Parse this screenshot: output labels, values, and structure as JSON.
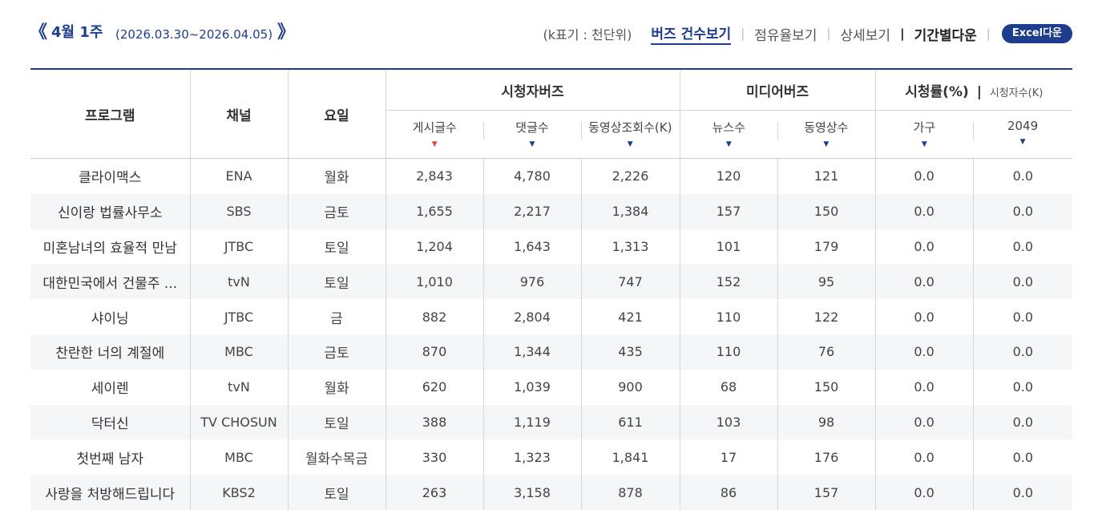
{
  "header": {
    "prev_icon": "《",
    "next_icon": "》",
    "week_label": "4월 1주",
    "date_range": "(2026.03.30~2026.04.05)",
    "unit_note": "(k표기 : 천단위)",
    "links": {
      "buzz_count": "버즈 건수보기",
      "share": "점유율보기",
      "detail": "상세보기",
      "period_download": "기간별다운"
    },
    "separator": "|",
    "excel_button": "Excel다운"
  },
  "table": {
    "headers": {
      "program": "프로그램",
      "channel": "채널",
      "day": "요일",
      "viewer_buzz": "시청자버즈",
      "media_buzz": "미디어버즈",
      "ratings": "시청률(%)",
      "ratings_sep": "|",
      "viewers_k": "시청자수(K)",
      "sub": [
        "게시글수",
        "댓글수",
        "동영상조회수(K)",
        "뉴스수",
        "동영상수",
        "가구",
        "2049"
      ]
    },
    "sort_up_icon": "▼",
    "sort_down_icon": "▼",
    "rows": [
      {
        "program": "클라이맥스",
        "channel": "ENA",
        "day": "월화",
        "posts": "2,843",
        "comments": "4,780",
        "video_views": "2,226",
        "news": "120",
        "videos": "121",
        "household": "0.0",
        "r2049": "0.0"
      },
      {
        "program": "신이랑 법률사무소",
        "channel": "SBS",
        "day": "금토",
        "posts": "1,655",
        "comments": "2,217",
        "video_views": "1,384",
        "news": "157",
        "videos": "150",
        "household": "0.0",
        "r2049": "0.0"
      },
      {
        "program": "미혼남녀의 효율적 만남",
        "channel": "JTBC",
        "day": "토일",
        "posts": "1,204",
        "comments": "1,643",
        "video_views": "1,313",
        "news": "101",
        "videos": "179",
        "household": "0.0",
        "r2049": "0.0"
      },
      {
        "program": "대한민국에서 건물주 ...",
        "channel": "tvN",
        "day": "토일",
        "posts": "1,010",
        "comments": "976",
        "video_views": "747",
        "news": "152",
        "videos": "95",
        "household": "0.0",
        "r2049": "0.0"
      },
      {
        "program": "샤이닝",
        "channel": "JTBC",
        "day": "금",
        "posts": "882",
        "comments": "2,804",
        "video_views": "421",
        "news": "110",
        "videos": "122",
        "household": "0.0",
        "r2049": "0.0"
      },
      {
        "program": "찬란한 너의 계절에",
        "channel": "MBC",
        "day": "금토",
        "posts": "870",
        "comments": "1,344",
        "video_views": "435",
        "news": "110",
        "videos": "76",
        "household": "0.0",
        "r2049": "0.0"
      },
      {
        "program": "세이렌",
        "channel": "tvN",
        "day": "월화",
        "posts": "620",
        "comments": "1,039",
        "video_views": "900",
        "news": "68",
        "videos": "150",
        "household": "0.0",
        "r2049": "0.0"
      },
      {
        "program": "닥터신",
        "channel": "TV CHOSUN",
        "day": "토일",
        "posts": "388",
        "comments": "1,119",
        "video_views": "611",
        "news": "103",
        "videos": "98",
        "household": "0.0",
        "r2049": "0.0"
      },
      {
        "program": "첫번째 남자",
        "channel": "MBC",
        "day": "월화수목금",
        "posts": "330",
        "comments": "1,323",
        "video_views": "1,841",
        "news": "17",
        "videos": "176",
        "household": "0.0",
        "r2049": "0.0"
      },
      {
        "program": "사랑을 처방해드립니다",
        "channel": "KBS2",
        "day": "토일",
        "posts": "263",
        "comments": "3,158",
        "video_views": "878",
        "news": "86",
        "videos": "157",
        "household": "0.0",
        "r2049": "0.0"
      }
    ]
  }
}
